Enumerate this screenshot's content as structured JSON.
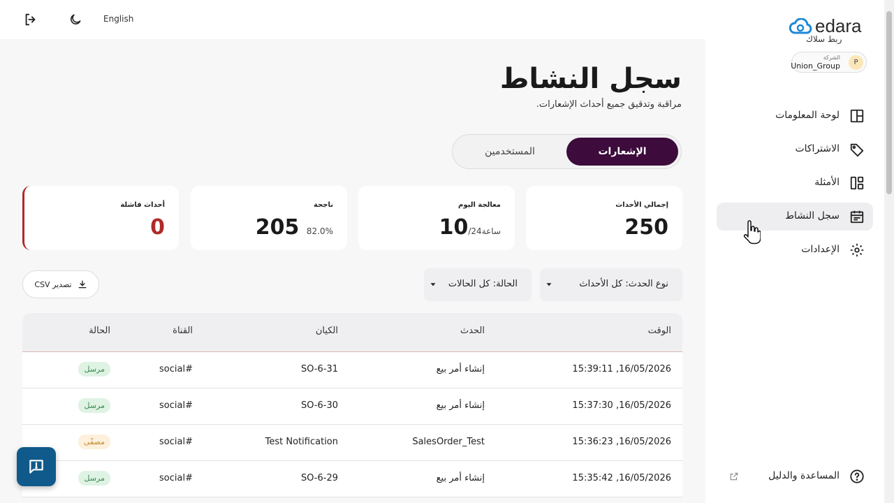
{
  "topbar": {
    "language": "English"
  },
  "page": {
    "title": "سجل النشاط",
    "subtitle": "مراقبة وتدقيق جميع أحداث الإشعارات."
  },
  "tabs": [
    {
      "label": "الإشعارات",
      "active": true
    },
    {
      "label": "المستخدمين",
      "active": false
    }
  ],
  "stats": {
    "total": {
      "label": "إجمالي الأحداث",
      "value": "250"
    },
    "today": {
      "label": "معالجة اليوم",
      "value": "10",
      "suffix": "/24",
      "unit": "ساعة"
    },
    "success": {
      "label": "ناجحة",
      "value": "205",
      "percent": "82.0%"
    },
    "failed": {
      "label": "أحداث فاشلة",
      "value": "0"
    }
  },
  "filters": {
    "event_type": "نوع الحدث: كل الأحداث",
    "status": "الحالة: كل الحالات"
  },
  "export_label": "تصدير CSV",
  "table": {
    "headers": {
      "time": "الوقت",
      "event": "الحدث",
      "entity": "الكيان",
      "channel": "القناة",
      "status": "الحالة"
    },
    "rows": [
      {
        "time": "15:39:11 ,16/05/2026",
        "event": "إنشاء أمر بيع",
        "entity": "SO-6-31",
        "channel": "social#",
        "status": "مرسل"
      },
      {
        "time": "15:37:30 ,16/05/2026",
        "event": "إنشاء أمر بيع",
        "entity": "SO-6-30",
        "channel": "social#",
        "status": "مرسل"
      },
      {
        "time": "15:36:23 ,16/05/2026",
        "event": "SalesOrder_Test",
        "entity": "Test Notification",
        "channel": "social#",
        "status": "مصفًى"
      },
      {
        "time": "15:35:42 ,16/05/2026",
        "event": "إنشاء أمر بيع",
        "entity": "SO-6-29",
        "channel": "social#",
        "status": "مرسل"
      }
    ]
  },
  "sidebar": {
    "brand": "edara",
    "brand_sub": "ربط سلاك",
    "company_label": "الشركة",
    "company_name": "Union_Group",
    "company_initial": "P",
    "items": [
      {
        "label": "لوحة المعلومات",
        "icon": "dashboard-icon"
      },
      {
        "label": "الاشتراكات",
        "icon": "tag-icon"
      },
      {
        "label": "الأمثلة",
        "icon": "templates-icon"
      },
      {
        "label": "سجل النشاط",
        "icon": "calendar-log-icon",
        "active": true
      },
      {
        "label": "الإعدادات",
        "icon": "gear-icon"
      }
    ],
    "help": "المساعدة والدليل"
  },
  "colors": {
    "accent": "#3d0b3c",
    "failed": "#b02a2a",
    "sent_bg": "#dff3e4",
    "filtered_bg": "#fdf0dc",
    "fab": "#0f5a8a"
  }
}
